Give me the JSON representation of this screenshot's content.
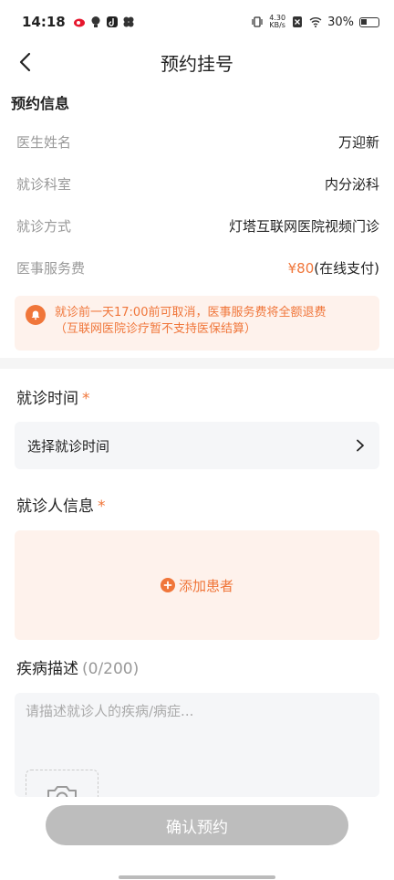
{
  "status_bar": {
    "time": "14:18",
    "net_speed_value": "4.30",
    "net_speed_unit": "KB/s",
    "battery": "30%"
  },
  "nav": {
    "title": "预约挂号"
  },
  "appointment_info": {
    "section_title": "预约信息",
    "rows": [
      {
        "label": "医生姓名",
        "value": "万迎新"
      },
      {
        "label": "就诊科室",
        "value": "内分泌科"
      },
      {
        "label": "就诊方式",
        "value": "灯塔互联网医院视频门诊"
      }
    ],
    "fee": {
      "label": "医事服务费",
      "amount": "¥80",
      "suffix": "(在线支付)"
    },
    "notice": {
      "line1": "就诊前一天17:00前可取消，医事服务费将全额退费",
      "line2": "（互联网医院诊疗暂不支持医保结算）"
    }
  },
  "visit_time": {
    "label": "就诊时间",
    "required_mark": "*",
    "picker_text": "选择就诊时间"
  },
  "patient_info": {
    "label": "就诊人信息",
    "required_mark": "*",
    "add_text": "添加患者"
  },
  "disease_description": {
    "label": "疾病描述",
    "count": "(0/200)",
    "placeholder": "请描述就诊人的疾病/病症..."
  },
  "confirm_button": {
    "label": "确认预约"
  },
  "colors": {
    "accent": "#f0763a",
    "disabled_button": "#bdbdbd",
    "field_bg": "#f5f6f8",
    "tint_bg": "#fef2ec"
  }
}
